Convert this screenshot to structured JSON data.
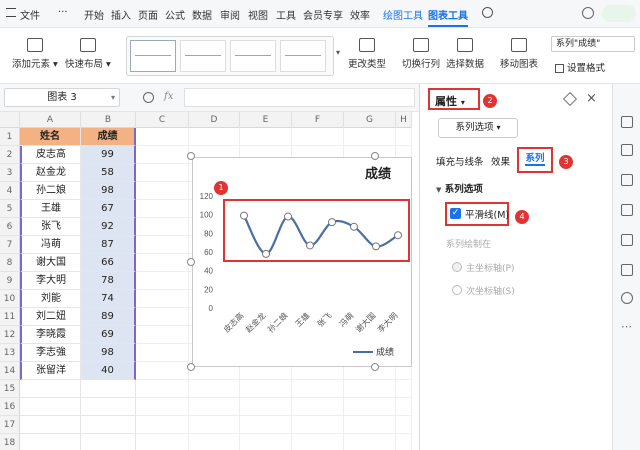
{
  "menubar": {
    "file": "文件",
    "more": "···",
    "tabs": [
      "开始",
      "插入",
      "页面",
      "公式",
      "数据",
      "审阅",
      "视图",
      "工具",
      "会员专享",
      "效率"
    ],
    "chart_tools_tab": "绘图工具",
    "chart_tools_active": "图表工具"
  },
  "ribbon": {
    "add_element": "添加元素",
    "quick_layout": "快速布局",
    "change_type": "更改类型",
    "switch_rowcol": "切换行列",
    "select_data": "选择数据",
    "move_chart": "移动图表",
    "series_selector": "系列\"成绩\"",
    "format_setting": "设置格式"
  },
  "formula_bar": {
    "name_box": "图表 3",
    "fx": "fx"
  },
  "sheet": {
    "columns": [
      "A",
      "B",
      "C",
      "D",
      "E",
      "F",
      "G",
      "H"
    ],
    "rows": [
      "1",
      "2",
      "3",
      "4",
      "5",
      "6",
      "7",
      "8",
      "9",
      "10",
      "11",
      "12",
      "13",
      "14",
      "15",
      "16",
      "17",
      "18"
    ],
    "header_name": "姓名",
    "header_score": "成绩",
    "names": [
      "皮志高",
      "赵金龙",
      "孙二娘",
      "王雄",
      "张飞",
      "冯萌",
      "谢大国",
      "李大明",
      "刘能",
      "刘二妞",
      "李晓霞",
      "李志強",
      "张留洋"
    ],
    "scores": [
      "99",
      "58",
      "98",
      "67",
      "92",
      "87",
      "66",
      "78",
      "74",
      "89",
      "69",
      "98",
      "40"
    ]
  },
  "chart_data": {
    "type": "line",
    "title": "成绩",
    "categories": [
      "皮志高",
      "赵金龙",
      "孙二娘",
      "王雄",
      "张飞",
      "冯萌",
      "谢大国",
      "李大明"
    ],
    "series": [
      {
        "name": "成绩",
        "values": [
          99,
          58,
          98,
          67,
          92,
          87,
          66,
          78
        ]
      }
    ],
    "yticks": [
      "120",
      "100",
      "80",
      "60",
      "40",
      "20",
      "0"
    ],
    "ylim": [
      0,
      120
    ],
    "smooth": true,
    "legend": "bottom-right",
    "color": "#4a6fa5"
  },
  "panel": {
    "title": "属性",
    "dropdown": "系列选项",
    "tab_fill": "填充与线条",
    "tab_effect": "效果",
    "tab_series": "系列",
    "section": "系列选项",
    "smooth_label": "平滑线(M)",
    "plot_on": "系列绘制在",
    "primary_axis": "主坐标轴(P)",
    "secondary_axis": "次坐标轴(S)"
  },
  "annotations": [
    "1",
    "2",
    "3",
    "4"
  ]
}
